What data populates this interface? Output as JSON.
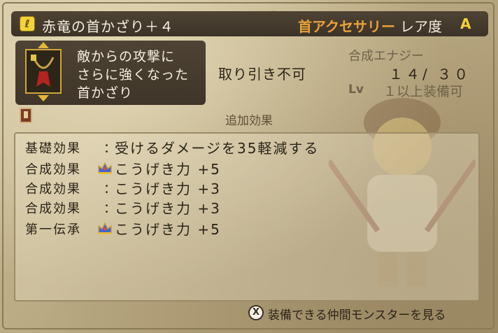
{
  "title_bar": {
    "icon": "accessory-slot-icon",
    "item_name": "赤竜の首かざり＋４",
    "category": "首アクセサリー",
    "rarity_label": "レア度",
    "rarity_value": "A"
  },
  "description": {
    "lines": [
      "敵からの攻撃に",
      "さらに強くなった",
      "首かざり"
    ]
  },
  "stats": {
    "synthesis_label": "合成エナジー",
    "trade_status": "取り引き不可",
    "energy_current": "１４",
    "energy_max": "３０",
    "lv_label": "Lv",
    "lv_requirement": "１以上装備可"
  },
  "effects": {
    "heading": "追加効果",
    "rows": [
      {
        "type": "基礎効果",
        "sep": "：",
        "icon": "",
        "text": "受けるダメージを35軽減する"
      },
      {
        "type": "合成効果",
        "sep": "",
        "icon": "crown-icon",
        "text": "こうげき力 +5"
      },
      {
        "type": "合成効果",
        "sep": "：",
        "icon": "",
        "text": "こうげき力 +3"
      },
      {
        "type": "合成効果",
        "sep": "：",
        "icon": "",
        "text": "こうげき力 +3"
      },
      {
        "type": "第一伝承",
        "sep": "",
        "icon": "crown-icon",
        "text": "こうげき力 +5"
      }
    ]
  },
  "footer": {
    "button_glyph": "X",
    "hint": "装備できる仲間モンスターを見る"
  },
  "colors": {
    "panel_dark": "#453a2d",
    "category_orange": "#e8a23a",
    "rarity_yellow": "#f3d23a",
    "text_dark": "#2b2418"
  }
}
